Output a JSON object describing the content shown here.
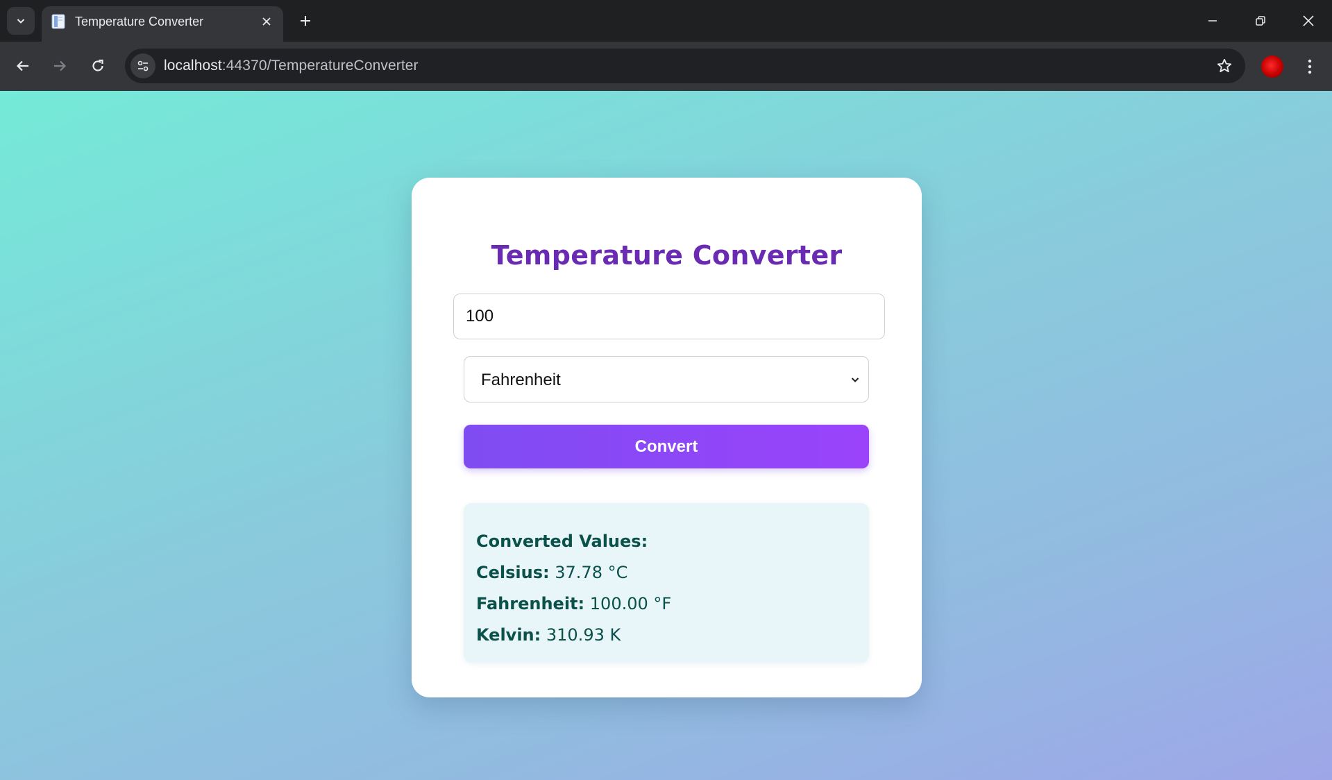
{
  "browser": {
    "tab_title": "Temperature Converter",
    "url_host": "localhost",
    "url_rest": ":44370/TemperatureConverter",
    "icons": {
      "tab_search": "chevron-down-icon",
      "favicon": "document-icon",
      "tab_close": "close-icon",
      "new_tab": "plus-icon",
      "minimize": "minimize-icon",
      "restore": "restore-icon",
      "close_window": "close-icon",
      "back": "arrow-left-icon",
      "forward": "arrow-right-icon",
      "reload": "reload-icon",
      "site_info": "tune-icon",
      "bookmark": "star-icon",
      "profile": "avatar",
      "menu": "kebab-menu-icon"
    }
  },
  "page": {
    "title": "Temperature Converter",
    "input_value": "100",
    "selected_unit": "Fahrenheit",
    "convert_label": "Convert",
    "results_heading": "Converted Values:",
    "results": [
      {
        "label": "Celsius:",
        "value": "37.78 °C"
      },
      {
        "label": "Fahrenheit:",
        "value": "100.00 °F"
      },
      {
        "label": "Kelvin:",
        "value": "310.93 K"
      }
    ]
  },
  "colors": {
    "title": "#6a2bb3",
    "button_start": "#7f4cf2",
    "button_end": "#9a43fb",
    "results_bg": "#e8f6fa",
    "results_text": "#0b5149",
    "background_start": "#74ead8",
    "background_end": "#9ea6e8"
  }
}
